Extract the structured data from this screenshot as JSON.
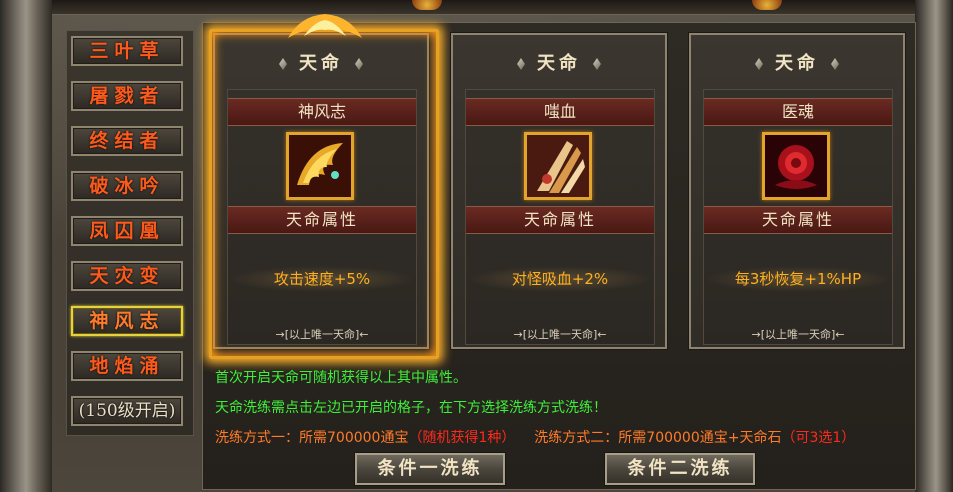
{
  "nav": {
    "items": [
      {
        "label": "三叶草",
        "state": "normal"
      },
      {
        "label": "屠戮者",
        "state": "normal"
      },
      {
        "label": "终结者",
        "state": "normal"
      },
      {
        "label": "破冰吟",
        "state": "normal"
      },
      {
        "label": "凤囚凰",
        "state": "normal"
      },
      {
        "label": "天灾变",
        "state": "normal"
      },
      {
        "label": "神风志",
        "state": "active"
      },
      {
        "label": "地焰涌",
        "state": "normal"
      },
      {
        "label": "(150级开启)",
        "state": "locked"
      }
    ]
  },
  "cards": [
    {
      "caption": "天命",
      "name": "神风志",
      "attr_title": "天命属性",
      "effect": "攻击速度+5%",
      "note": "→[以上唯一天命]←",
      "icon": "golden-wing-icon",
      "selected": true
    },
    {
      "caption": "天命",
      "name": "嗤血",
      "attr_title": "天命属性",
      "effect": "对怪吸血+2%",
      "note": "→[以上唯一天命]←",
      "icon": "claw-blade-icon",
      "selected": false
    },
    {
      "caption": "天命",
      "name": "医魂",
      "attr_title": "天命属性",
      "effect": "每3秒恢复+1%HP",
      "note": "→[以上唯一天命]←",
      "icon": "red-rose-icon",
      "selected": false
    }
  ],
  "info": {
    "line1": "首次开启天命可随机获得以上其中属性。",
    "line2": "天命洗练需点击左边已开启的格子，在下方选择洗练方式洗练！",
    "method1_prefix": "洗练方式一：所需700000通宝",
    "method1_suffix": "（随机获得1种）",
    "method2_prefix": "洗练方式二：所需700000通宝+天命石",
    "method2_suffix": "（可3选1）"
  },
  "buttons": {
    "refine1": "条件一洗练",
    "refine2": "条件二洗练"
  },
  "colors": {
    "nav_text": "#ff5a1c",
    "active_border": "#e6d23c",
    "effect_text": "#ffb020",
    "info_green": "#3ff03a",
    "info_red": "#ff2a1c"
  }
}
